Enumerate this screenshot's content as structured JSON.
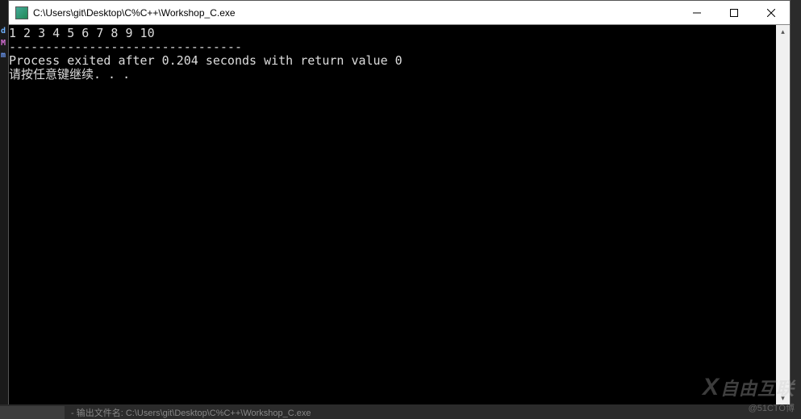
{
  "window": {
    "title": "C:\\Users\\git\\Desktop\\C%C++\\Workshop_C.exe"
  },
  "console": {
    "line1": "1 2 3 4 5 6 7 8 9 10",
    "divider": "--------------------------------",
    "exit_line": "Process exited after 0.204 seconds with return value 0",
    "prompt_line": "请按任意键继续. . ."
  },
  "gutter": {
    "g1": "d",
    "g2": "M",
    "g3": "m"
  },
  "bottom": {
    "text": "- 输出文件名: C:\\Users\\git\\Desktop\\C%C++\\Workshop_C.exe"
  },
  "watermark": {
    "main": "自由互联",
    "sub": "@51CTO博"
  }
}
